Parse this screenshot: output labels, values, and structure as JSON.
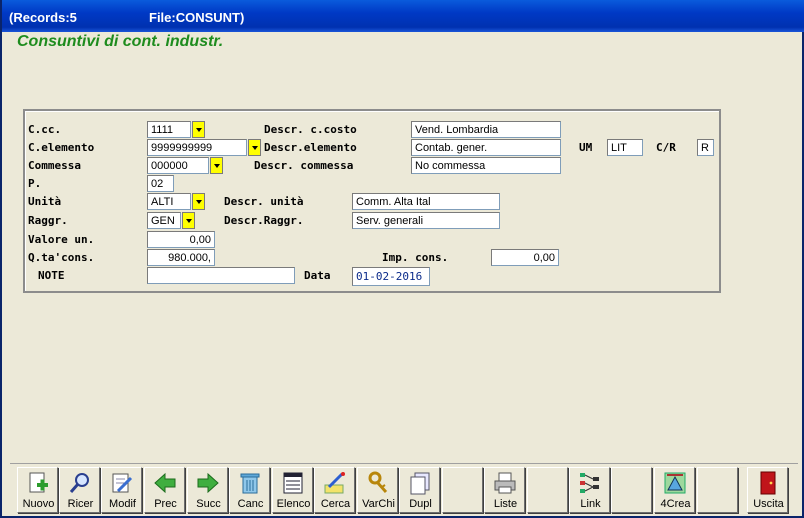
{
  "titlebar": {
    "records": "(Records:5",
    "file": "File:CONSUNT)"
  },
  "heading": "Consuntivi di cont. industr.",
  "form": {
    "ccc_label": "C.cc.",
    "ccc_value": "1111",
    "descr_ccosto_label": "Descr. c.costo",
    "descr_ccosto_value": "Vend. Lombardia",
    "celemento_label": "C.elemento",
    "celemento_value": "9999999999",
    "descr_elemento_label": "Descr.elemento",
    "descr_elemento_value": "Contab. gener.",
    "um_label": "UM",
    "um_value": "LIT",
    "cr_label": "C/R",
    "cr_value": "R",
    "commessa_label": "Commessa",
    "commessa_value": "000000",
    "descr_commessa_label": "Descr. commessa",
    "descr_commessa_value": "No commessa",
    "p_label": "P.",
    "p_value": "02",
    "unita_label": "Unità",
    "unita_value": "ALTI",
    "descr_unita_label": "Descr. unità",
    "descr_unita_value": "Comm. Alta Ital",
    "raggr_label": "Raggr.",
    "raggr_value": "GEN",
    "descr_raggr_label": "Descr.Raggr.",
    "descr_raggr_value": "Serv. generali",
    "valore_label": "Valore un.",
    "valore_value": "0,00",
    "qta_label": "Q.ta'cons.",
    "qta_value": "980.000,",
    "imp_label": "Imp. cons.",
    "imp_value": "0,00",
    "note_label": "NOTE",
    "note_value": "",
    "data_label": "Data",
    "data_value": "01-02-2016"
  },
  "toolbar": [
    {
      "label": "Nuovo",
      "icon": "new-doc-icon"
    },
    {
      "label": "Ricer",
      "icon": "search-icon"
    },
    {
      "label": "Modif",
      "icon": "edit-icon"
    },
    {
      "label": "Prec",
      "icon": "arrow-left-icon"
    },
    {
      "label": "Succ",
      "icon": "arrow-right-icon"
    },
    {
      "label": "Canc",
      "icon": "trash-icon"
    },
    {
      "label": "Elenco",
      "icon": "list-icon"
    },
    {
      "label": "Cerca",
      "icon": "find-icon"
    },
    {
      "label": "VarChi",
      "icon": "keys-icon"
    },
    {
      "label": "Dupl",
      "icon": "duplicate-icon"
    },
    {
      "label": "",
      "icon": ""
    },
    {
      "label": "Liste",
      "icon": "printer-icon"
    },
    {
      "label": "",
      "icon": ""
    },
    {
      "label": "Link",
      "icon": "link-icon"
    },
    {
      "label": "",
      "icon": ""
    },
    {
      "label": "4Crea",
      "icon": "create-icon"
    },
    {
      "label": "",
      "icon": ""
    },
    {
      "label": "Uscita",
      "icon": "exit-door-icon"
    }
  ]
}
